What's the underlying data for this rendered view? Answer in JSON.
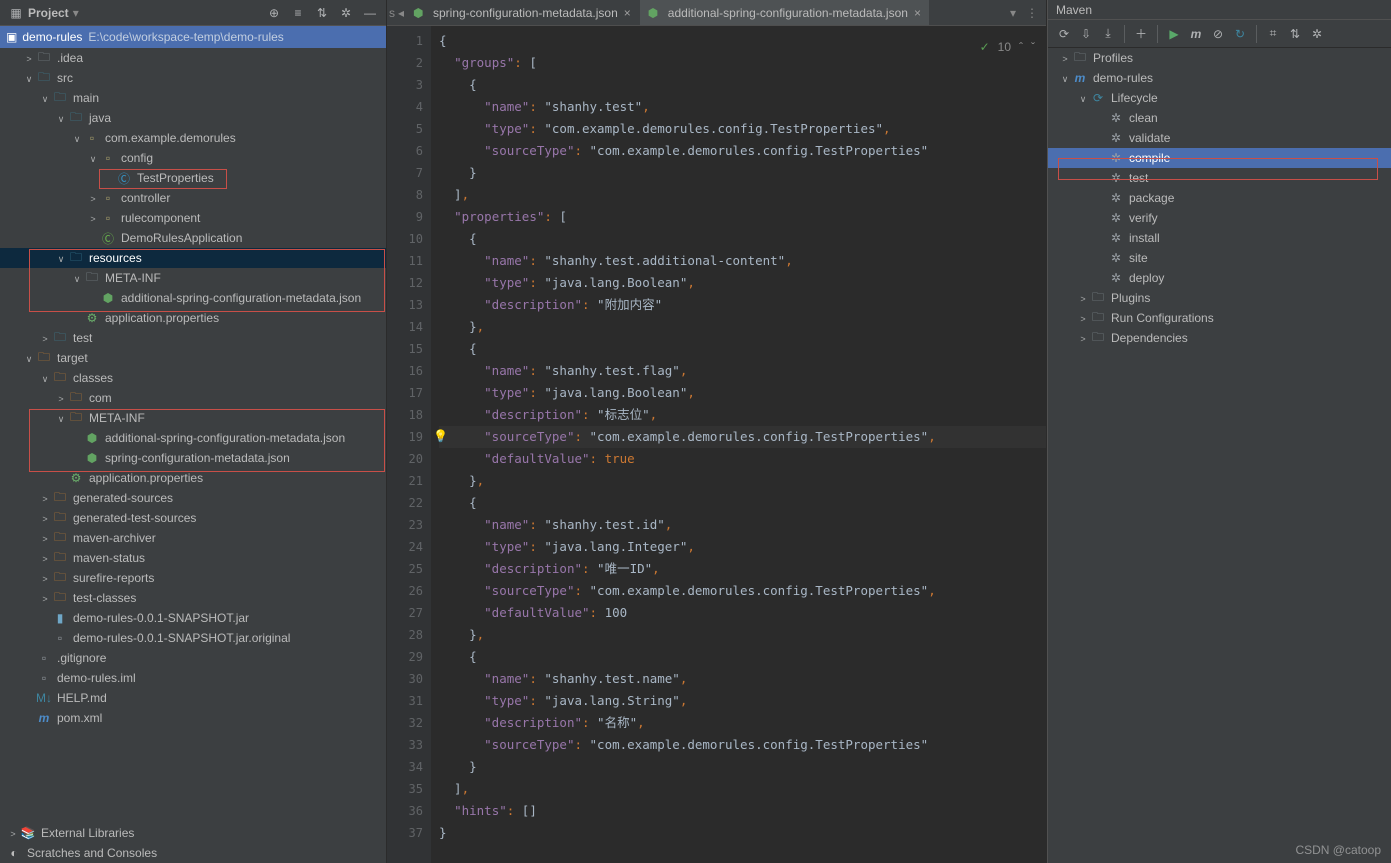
{
  "project": {
    "panel_title": "Project",
    "root_name": "demo-rules",
    "root_path": "E:\\code\\workspace-temp\\demo-rules",
    "tree": [
      {
        "d": 1,
        "a": "r",
        "kind": "folder",
        "col": "blue",
        "label": ".idea"
      },
      {
        "d": 1,
        "a": "d",
        "kind": "folder",
        "col": "teal",
        "label": "src"
      },
      {
        "d": 2,
        "a": "d",
        "kind": "folder",
        "col": "teal",
        "label": "main"
      },
      {
        "d": 3,
        "a": "d",
        "kind": "folder",
        "col": "teal",
        "label": "java"
      },
      {
        "d": 4,
        "a": "d",
        "kind": "pkg",
        "label": "com.example.demorules"
      },
      {
        "d": 5,
        "a": "d",
        "kind": "pkg",
        "label": "config"
      },
      {
        "d": 6,
        "a": "",
        "kind": "class",
        "label": "TestProperties",
        "hl": true
      },
      {
        "d": 5,
        "a": "r",
        "kind": "pkg",
        "label": "controller"
      },
      {
        "d": 5,
        "a": "r",
        "kind": "pkg",
        "label": "rulecomponent"
      },
      {
        "d": 5,
        "a": "",
        "kind": "sbclass",
        "label": "DemoRulesApplication"
      },
      {
        "d": 3,
        "a": "d",
        "kind": "folder",
        "col": "teal",
        "label": "resources",
        "sel": true
      },
      {
        "d": 4,
        "a": "d",
        "kind": "folder",
        "col": "blue",
        "label": "META-INF"
      },
      {
        "d": 5,
        "a": "",
        "kind": "jsonfile",
        "label": "additional-spring-configuration-metadata.json"
      },
      {
        "d": 4,
        "a": "",
        "kind": "propfile",
        "label": "application.properties"
      },
      {
        "d": 2,
        "a": "r",
        "kind": "folder",
        "col": "teal",
        "label": "test"
      },
      {
        "d": 1,
        "a": "d",
        "kind": "folder",
        "col": "orange",
        "label": "target"
      },
      {
        "d": 2,
        "a": "d",
        "kind": "folder",
        "col": "orange",
        "label": "classes"
      },
      {
        "d": 3,
        "a": "r",
        "kind": "folder",
        "col": "orange",
        "label": "com"
      },
      {
        "d": 3,
        "a": "d",
        "kind": "folder",
        "col": "orange",
        "label": "META-INF"
      },
      {
        "d": 4,
        "a": "",
        "kind": "jsonfile",
        "label": "additional-spring-configuration-metadata.json"
      },
      {
        "d": 4,
        "a": "",
        "kind": "jsonfile",
        "label": "spring-configuration-metadata.json"
      },
      {
        "d": 3,
        "a": "",
        "kind": "propfile",
        "label": "application.properties"
      },
      {
        "d": 2,
        "a": "r",
        "kind": "folder",
        "col": "orange",
        "label": "generated-sources"
      },
      {
        "d": 2,
        "a": "r",
        "kind": "folder",
        "col": "orange",
        "label": "generated-test-sources"
      },
      {
        "d": 2,
        "a": "r",
        "kind": "folder",
        "col": "orange",
        "label": "maven-archiver"
      },
      {
        "d": 2,
        "a": "r",
        "kind": "folder",
        "col": "orange",
        "label": "maven-status"
      },
      {
        "d": 2,
        "a": "r",
        "kind": "folder",
        "col": "orange",
        "label": "surefire-reports"
      },
      {
        "d": 2,
        "a": "r",
        "kind": "folder",
        "col": "orange",
        "label": "test-classes"
      },
      {
        "d": 2,
        "a": "",
        "kind": "jar",
        "label": "demo-rules-0.0.1-SNAPSHOT.jar"
      },
      {
        "d": 2,
        "a": "",
        "kind": "file",
        "label": "demo-rules-0.0.1-SNAPSHOT.jar.original"
      },
      {
        "d": 1,
        "a": "",
        "kind": "file",
        "label": ".gitignore"
      },
      {
        "d": 1,
        "a": "",
        "kind": "file",
        "label": "demo-rules.iml"
      },
      {
        "d": 1,
        "a": "",
        "kind": "md",
        "label": "HELP.md"
      },
      {
        "d": 1,
        "a": "",
        "kind": "mvn",
        "label": "pom.xml"
      }
    ],
    "ext_lib": "External Libraries",
    "scratches": "Scratches and Consoles"
  },
  "tabs": {
    "t1": "spring-configuration-metadata.json",
    "t2": "additional-spring-configuration-metadata.json",
    "checks": "10"
  },
  "editor": {
    "lines": [
      "{",
      "  \"groups\": [",
      "    {",
      "      \"name\": \"shanhy.test\",",
      "      \"type\": \"com.example.demorules.config.TestProperties\",",
      "      \"sourceType\": \"com.example.demorules.config.TestProperties\"",
      "    }",
      "  ],",
      "  \"properties\": [",
      "    {",
      "      \"name\": \"shanhy.test.additional-content\",",
      "      \"type\": \"java.lang.Boolean\",",
      "      \"description\": \"附加内容\"",
      "    },",
      "    {",
      "      \"name\": \"shanhy.test.flag\",",
      "      \"type\": \"java.lang.Boolean\",",
      "      \"description\": \"标志位\",",
      "      \"sourceType\": \"com.example.demorules.config.TestProperties\",",
      "      \"defaultValue\": true",
      "    },",
      "    {",
      "      \"name\": \"shanhy.test.id\",",
      "      \"type\": \"java.lang.Integer\",",
      "      \"description\": \"唯一ID\",",
      "      \"sourceType\": \"com.example.demorules.config.TestProperties\",",
      "      \"defaultValue\": 100",
      "    },",
      "    {",
      "      \"name\": \"shanhy.test.name\",",
      "      \"type\": \"java.lang.String\",",
      "      \"description\": \"名称\",",
      "      \"sourceType\": \"com.example.demorules.config.TestProperties\"",
      "    }",
      "  ],",
      "  \"hints\": []",
      "}"
    ]
  },
  "maven": {
    "title": "Maven",
    "nodes": [
      {
        "d": 0,
        "a": "r",
        "kind": "folder",
        "label": "Profiles"
      },
      {
        "d": 0,
        "a": "d",
        "kind": "mvnproj",
        "label": "demo-rules"
      },
      {
        "d": 1,
        "a": "d",
        "kind": "lifecycle",
        "label": "Lifecycle"
      },
      {
        "d": 2,
        "a": "",
        "kind": "goal",
        "label": "clean"
      },
      {
        "d": 2,
        "a": "",
        "kind": "goal",
        "label": "validate"
      },
      {
        "d": 2,
        "a": "",
        "kind": "goal",
        "label": "compile",
        "sel": true,
        "hl": true
      },
      {
        "d": 2,
        "a": "",
        "kind": "goal",
        "label": "test"
      },
      {
        "d": 2,
        "a": "",
        "kind": "goal",
        "label": "package"
      },
      {
        "d": 2,
        "a": "",
        "kind": "goal",
        "label": "verify"
      },
      {
        "d": 2,
        "a": "",
        "kind": "goal",
        "label": "install"
      },
      {
        "d": 2,
        "a": "",
        "kind": "goal",
        "label": "site"
      },
      {
        "d": 2,
        "a": "",
        "kind": "goal",
        "label": "deploy"
      },
      {
        "d": 1,
        "a": "r",
        "kind": "folder",
        "label": "Plugins"
      },
      {
        "d": 1,
        "a": "r",
        "kind": "folder",
        "label": "Run Configurations"
      },
      {
        "d": 1,
        "a": "r",
        "kind": "folder",
        "label": "Dependencies"
      }
    ]
  },
  "watermark": "CSDN @catoop"
}
